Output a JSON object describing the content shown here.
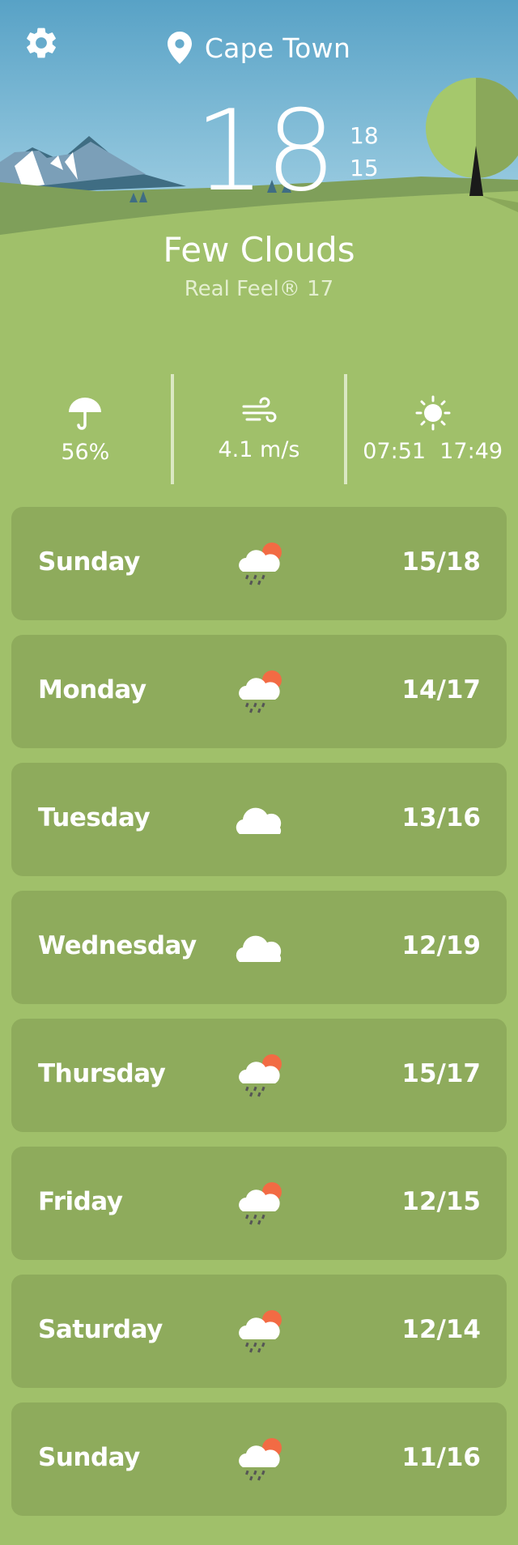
{
  "location": {
    "city": "Cape Town"
  },
  "current": {
    "temperature": "18",
    "high": "18",
    "low": "15",
    "condition": "Few Clouds",
    "real_feel": "Real Feel® 17"
  },
  "stats": {
    "precipitation": "56%",
    "wind": "4.1 m/s",
    "sunrise_sunset": "07:51  17:49"
  },
  "forecast": [
    {
      "day": "Sunday",
      "temps": "15/18",
      "icon": "rain-sun-icon"
    },
    {
      "day": "Monday",
      "temps": "14/17",
      "icon": "rain-sun-icon"
    },
    {
      "day": "Tuesday",
      "temps": "13/16",
      "icon": "cloud-icon"
    },
    {
      "day": "Wednesday",
      "temps": "12/19",
      "icon": "cloud-icon"
    },
    {
      "day": "Thursday",
      "temps": "15/17",
      "icon": "rain-sun-icon"
    },
    {
      "day": "Friday",
      "temps": "12/15",
      "icon": "rain-sun-icon"
    },
    {
      "day": "Saturday",
      "temps": "12/14",
      "icon": "rain-sun-icon"
    },
    {
      "day": "Sunday",
      "temps": "11/16",
      "icon": "rain-sun-icon"
    }
  ],
  "colors": {
    "grass": "#a0c06a",
    "card": "#8eab5c",
    "sky_top": "#5aa4c8",
    "sun_orange": "#f26b44"
  }
}
